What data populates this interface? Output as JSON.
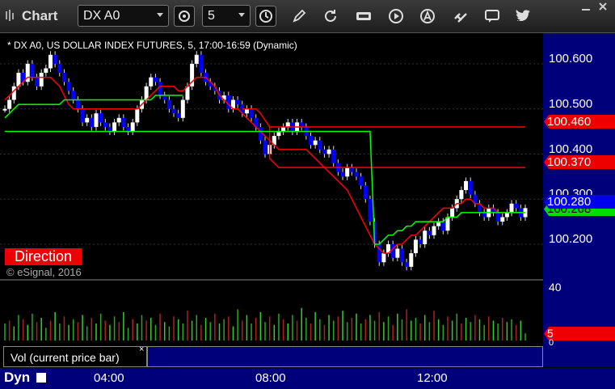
{
  "window": {
    "title": "Chart"
  },
  "toolbar": {
    "symbol": "DX A0",
    "interval": "5"
  },
  "chart": {
    "header": "* DX A0, US DOLLAR INDEX FUTURES, 5, 17:00-16:59 (Dynamic)",
    "direction_label": "Direction",
    "copyright": "© eSignal, 2016",
    "y_ticks": [
      "100.600",
      "100.500",
      "100.400",
      "100.300",
      "100.200"
    ],
    "price_tags": {
      "resistance_1": "100.460",
      "resistance_2": "100.370",
      "current": "100.280",
      "support_hidden": "100.268"
    },
    "x_ticks": [
      "04:00",
      "08:00",
      "12:00"
    ],
    "colors": {
      "background": "#000000",
      "up_candle": "#ffffff",
      "down_candle": "#0000ff",
      "red_line": "#ff0000",
      "green_line": "#00ff00",
      "axis_bg": "#00007a"
    }
  },
  "volume": {
    "label": "Vol (current price bar)",
    "top_tick": "40",
    "current": "5",
    "low_tick": "0"
  },
  "footer": {
    "label": "Dyn"
  },
  "chart_data": {
    "type": "candlestick",
    "title": "* DX A0, US DOLLAR INDEX FUTURES, 5, 17:00-16:59 (Dynamic)",
    "ylim": [
      100.13,
      100.65
    ],
    "x_ticks": [
      "04:00",
      "08:00",
      "12:00"
    ],
    "closes": [
      100.5,
      100.52,
      100.55,
      100.58,
      100.56,
      100.6,
      100.57,
      100.55,
      100.58,
      100.59,
      100.62,
      100.6,
      100.58,
      100.56,
      100.54,
      100.52,
      100.5,
      100.47,
      100.48,
      100.46,
      100.49,
      100.47,
      100.46,
      100.45,
      100.47,
      100.48,
      100.46,
      100.45,
      100.47,
      100.5,
      100.52,
      100.55,
      100.57,
      100.56,
      100.53,
      100.52,
      100.5,
      100.49,
      100.48,
      100.52,
      100.55,
      100.6,
      100.62,
      100.58,
      100.56,
      100.55,
      100.54,
      100.52,
      100.53,
      100.5,
      100.52,
      100.51,
      100.49,
      100.5,
      100.48,
      100.46,
      100.43,
      100.4,
      100.42,
      100.44,
      100.45,
      100.46,
      100.47,
      100.45,
      100.47,
      100.46,
      100.44,
      100.42,
      100.43,
      100.41,
      100.4,
      100.41,
      100.38,
      100.36,
      100.35,
      100.37,
      100.36,
      100.35,
      100.33,
      100.3,
      100.25,
      100.2,
      100.16,
      100.18,
      100.2,
      100.17,
      100.19,
      100.16,
      100.15,
      100.18,
      100.21,
      100.2,
      100.23,
      100.22,
      100.24,
      100.25,
      100.23,
      100.26,
      100.28,
      100.3,
      100.32,
      100.34,
      100.31,
      100.29,
      100.27,
      100.26,
      100.28,
      100.27,
      100.25,
      100.26,
      100.27,
      100.29,
      100.28,
      100.26,
      100.28
    ],
    "red_line": [
      100.52,
      100.53,
      100.54,
      100.55,
      100.56,
      100.57,
      100.57,
      100.57,
      100.57,
      100.57,
      100.57,
      100.56,
      100.55,
      100.53,
      100.51,
      100.5,
      100.5,
      100.5,
      100.5,
      100.5,
      100.5,
      100.5,
      100.5,
      100.5,
      100.5,
      100.5,
      100.5,
      100.5,
      100.5,
      100.5,
      100.51,
      100.52,
      100.53,
      100.54,
      100.55,
      100.55,
      100.55,
      100.55,
      100.54,
      100.54,
      100.55,
      100.56,
      100.57,
      100.57,
      100.57,
      100.56,
      100.55,
      100.53,
      100.52,
      100.51,
      100.5,
      100.5,
      100.49,
      100.48,
      100.47,
      100.46,
      100.45,
      100.44,
      100.43,
      100.42,
      100.41,
      100.41,
      100.41,
      100.41,
      100.41,
      100.41,
      100.41,
      100.4,
      100.39,
      100.38,
      100.37,
      100.36,
      100.35,
      100.34,
      100.33,
      100.32,
      100.3,
      100.28,
      100.26,
      100.24,
      100.22,
      100.2,
      100.19,
      100.18,
      100.18,
      100.19,
      100.2,
      100.2,
      100.21,
      100.22,
      100.22,
      100.23,
      100.24,
      100.25,
      100.26,
      100.27,
      100.28,
      100.28,
      100.28,
      100.29,
      100.29,
      100.3,
      100.3,
      100.29,
      100.29,
      100.28,
      100.28,
      100.28,
      100.27,
      100.27,
      100.27,
      100.27,
      100.27,
      100.27,
      100.27
    ],
    "step_red": {
      "level_1": 100.46,
      "level_2": 100.37
    },
    "green_line": [
      100.48,
      100.49,
      100.5,
      100.51,
      100.51,
      100.51,
      100.51,
      100.51,
      100.51,
      100.51,
      100.51,
      100.51,
      100.51,
      100.52,
      100.52,
      100.52,
      100.52,
      100.52,
      100.52,
      100.52,
      100.52,
      100.52,
      100.52,
      100.52,
      100.52,
      100.52,
      100.52,
      100.52,
      100.52,
      100.52,
      100.52,
      100.52,
      100.52,
      100.53,
      100.53,
      100.53,
      100.53,
      100.53,
      100.53,
      100.53,
      100.54,
      100.54,
      100.54,
      100.54,
      100.54,
      100.54,
      100.54,
      100.54,
      100.54,
      100.54,
      100.54,
      100.54,
      100.54,
      100.54,
      100.54,
      100.54,
      100.54,
      100.54,
      100.54,
      100.54,
      100.54,
      100.54,
      100.54,
      100.54,
      100.54,
      100.54,
      100.54,
      100.54,
      100.54,
      100.54,
      100.54,
      100.54,
      100.54,
      100.54,
      100.54,
      100.54,
      100.54,
      100.54,
      100.54,
      100.54,
      100.54,
      100.54,
      100.54,
      100.54,
      100.54,
      100.54,
      100.54,
      100.54,
      100.54,
      100.54,
      100.54,
      100.54,
      100.54,
      100.54,
      100.54,
      100.54,
      100.54,
      100.54,
      100.54,
      100.54,
      100.54,
      100.54,
      100.54,
      100.54,
      100.54,
      100.54,
      100.54,
      100.54,
      100.54,
      100.54,
      100.54,
      100.54,
      100.54,
      100.54,
      100.54
    ],
    "green_support": [
      100.45,
      100.45,
      100.45,
      100.45,
      100.45,
      100.45,
      100.45,
      100.45,
      100.45,
      100.45,
      100.45,
      100.45,
      100.45,
      100.45,
      100.45,
      100.45,
      100.45,
      100.45,
      100.45,
      100.45,
      100.45,
      100.45,
      100.45,
      100.45,
      100.45,
      100.45,
      100.45,
      100.45,
      100.45,
      100.45,
      100.45,
      100.45,
      100.45,
      100.45,
      100.45,
      100.45,
      100.45,
      100.45,
      100.45,
      100.45,
      100.45,
      100.45,
      100.45,
      100.45,
      100.45,
      100.45,
      100.45,
      100.45,
      100.45,
      100.45,
      100.45,
      100.45,
      100.45,
      100.45,
      100.45,
      100.45,
      100.45,
      100.45,
      100.45,
      100.45,
      100.45,
      100.45,
      100.45,
      100.45,
      100.45,
      100.45,
      100.45,
      100.45,
      100.45,
      100.45,
      100.45,
      100.45,
      100.45,
      100.45,
      100.45,
      100.45,
      100.45,
      100.45,
      100.45,
      100.45,
      100.45,
      100.2,
      100.2,
      100.21,
      100.22,
      100.22,
      100.23,
      100.23,
      100.24,
      100.24,
      100.25,
      100.25,
      100.25,
      100.25,
      100.25,
      100.25,
      100.25,
      100.26,
      100.26,
      100.26,
      100.27,
      100.27,
      100.27,
      100.27,
      100.27,
      100.27,
      100.27,
      100.27,
      100.27,
      100.27,
      100.27,
      100.27,
      100.27,
      100.27,
      100.27
    ],
    "volume_ylim": [
      0,
      40
    ],
    "volume": [
      12,
      14,
      10,
      18,
      15,
      11,
      19,
      13,
      16,
      9,
      14,
      20,
      12,
      17,
      11,
      15,
      13,
      18,
      10,
      16,
      12,
      19,
      14,
      11,
      17,
      13,
      20,
      9,
      15,
      12,
      18,
      14,
      16,
      11,
      19,
      13,
      10,
      17,
      15,
      12,
      21,
      14,
      18,
      11,
      16,
      13,
      19,
      12,
      15,
      17,
      10,
      22,
      14,
      18,
      12,
      16,
      20,
      13,
      17,
      11,
      19,
      15,
      12,
      18,
      14,
      23,
      16,
      12,
      20,
      15,
      11,
      18,
      14,
      17,
      21,
      13,
      16,
      19,
      12,
      15,
      18,
      14,
      20,
      13,
      17,
      11,
      19,
      15,
      22,
      14,
      16,
      12,
      18,
      13,
      21,
      15,
      11,
      17,
      14,
      19,
      12,
      16,
      13,
      18,
      15,
      11,
      17,
      14,
      12,
      16,
      13,
      15,
      11,
      14,
      5
    ]
  }
}
